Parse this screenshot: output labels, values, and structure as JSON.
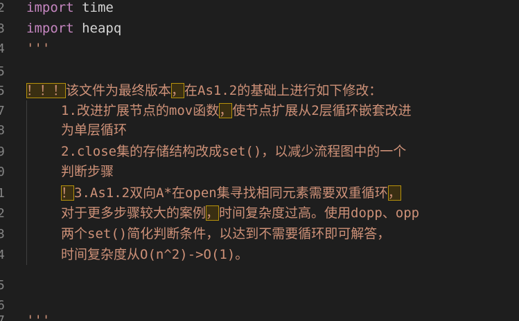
{
  "lines": [
    {
      "num": "2",
      "parts": [
        {
          "t": "import",
          "c": "kw"
        },
        {
          "t": " time",
          "c": "plain"
        }
      ]
    },
    {
      "num": "3",
      "parts": [
        {
          "t": "import",
          "c": "kw"
        },
        {
          "t": " heapq",
          "c": "plain"
        }
      ]
    },
    {
      "num": "4",
      "parts": [
        {
          "t": "'''",
          "c": "str"
        }
      ]
    },
    {
      "num": "5",
      "parts": []
    },
    {
      "num": "5",
      "parts": [
        {
          "t": "！！！",
          "c": "hl"
        },
        {
          "t": "该文件为最终版本",
          "c": "str"
        },
        {
          "t": "，",
          "c": "hl"
        },
        {
          "t": "在As1.2的基础上进行如下修改：",
          "c": "str"
        }
      ]
    },
    {
      "num": "7",
      "indent": true,
      "parts": [
        {
          "t": "1.改进扩展节点的mov函数",
          "c": "str"
        },
        {
          "t": "，",
          "c": "hl"
        },
        {
          "t": "使节点扩展从2层循环嵌套改进",
          "c": "str"
        }
      ]
    },
    {
      "num": "8",
      "indent": true,
      "parts": [
        {
          "t": "为单层循环",
          "c": "str"
        }
      ]
    },
    {
      "num": "9",
      "indent": true,
      "parts": [
        {
          "t": "2.close集的存储结构改成set()，以减少流程图中的一个",
          "c": "str"
        }
      ]
    },
    {
      "num": "0",
      "indent": true,
      "parts": [
        {
          "t": "判断步骤",
          "c": "str"
        }
      ]
    },
    {
      "num": "1",
      "indent": true,
      "parts": [
        {
          "t": "！",
          "c": "hl"
        },
        {
          "t": "3.As1.2双向A*在open集寻找相同元素需要双重循环",
          "c": "str"
        },
        {
          "t": "，",
          "c": "hl"
        }
      ]
    },
    {
      "num": "2",
      "indent": true,
      "parts": [
        {
          "t": "对于更多步骤较大的案例",
          "c": "str"
        },
        {
          "t": "，",
          "c": "hl"
        },
        {
          "t": "时间复杂度过高。使用dopp、opp",
          "c": "str"
        }
      ]
    },
    {
      "num": "3",
      "indent": true,
      "parts": [
        {
          "t": "两个set()简化判断条件，以达到不需要循环即可解答，",
          "c": "str"
        }
      ]
    },
    {
      "num": "4",
      "indent": true,
      "parts": [
        {
          "t": "时间复杂度从O(n^2)->O(1)。",
          "c": "str"
        }
      ]
    },
    {
      "num": "5",
      "parts": []
    },
    {
      "num": "6",
      "parts": []
    },
    {
      "num": "7",
      "parts": [
        {
          "t": "'''",
          "c": "str"
        }
      ]
    }
  ]
}
